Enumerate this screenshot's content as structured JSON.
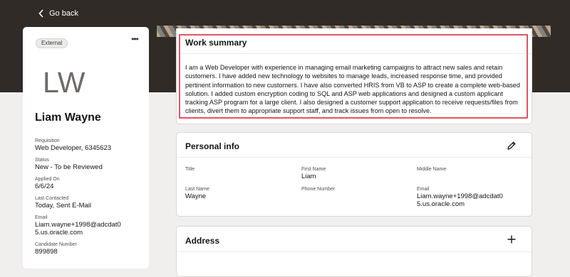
{
  "nav": {
    "back_label": "Go back"
  },
  "candidate": {
    "badge": "External",
    "initials": "LW",
    "name": "Liam Wayne",
    "fields": [
      {
        "label": "Requisition",
        "value": "Web Developer, 6345623"
      },
      {
        "label": "Status",
        "value": "New - To be Reviewed"
      },
      {
        "label": "Applied On",
        "value": "6/6/24"
      },
      {
        "label": "Last Contacted",
        "value": "Today, Sent E-Mail"
      },
      {
        "label": "Email",
        "value": "Liam.wayne+1998@adcdat05.us.oracle.com"
      },
      {
        "label": "Candidate Number",
        "value": "899898"
      }
    ]
  },
  "work_summary": {
    "title": "Work summary",
    "text": "I am a Web Developer with experience in managing email marketing campaigns to attract new sales and retain customers. I have added new technology to websites to manage leads, increased response time, and provided pertinent information to new customers. I have also converted HRIS from VB to ASP to create a complete web-based solution. I added custom encryption coding to SQL and ASP web applications and designed a custom applicant tracking ASP program for a large client. I also designed a customer support application to receive requests/files from clients, divert them to appropriate support staff, and track issues from open to resolve."
  },
  "personal_info": {
    "title": "Personal info",
    "fields": {
      "title": {
        "label": "Title",
        "value": ""
      },
      "first_name": {
        "label": "First Name",
        "value": "Liam"
      },
      "middle_name": {
        "label": "Middle Name",
        "value": ""
      },
      "last_name": {
        "label": "Last Name",
        "value": "Wayne"
      },
      "phone": {
        "label": "Phone Number",
        "value": ""
      },
      "email": {
        "label": "Email",
        "value": "Liam.wayne+1998@adcdat05.us.oracle.com"
      }
    }
  },
  "address": {
    "title": "Address"
  },
  "colors": {
    "header_bg": "#302b27",
    "highlight": "#e05563",
    "page_bg": "#f1efed"
  },
  "icons": {
    "back": "chevron-left-icon",
    "more": "more-dots-icon",
    "edit": "pencil-icon",
    "add": "plus-icon"
  }
}
